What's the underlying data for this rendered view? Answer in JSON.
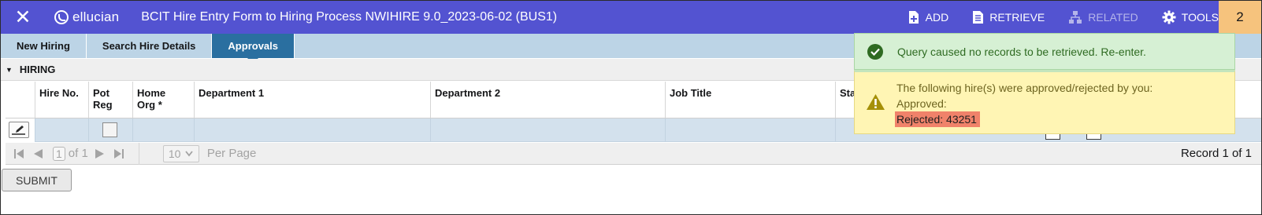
{
  "header": {
    "close_label": "✕",
    "logo_text": "ellucian",
    "form_title": "BCIT Hire Entry Form to Hiring Process NWIHIRE 9.0_2023-06-02 (BUS1)",
    "tools": [
      {
        "label": "ADD",
        "icon": "add-document-icon"
      },
      {
        "label": "RETRIEVE",
        "icon": "retrieve-document-icon"
      },
      {
        "label": "RELATED",
        "icon": "sitemap-icon",
        "disabled": true
      },
      {
        "label": "TOOLS",
        "icon": "gear-icon"
      }
    ],
    "notification_count": "2"
  },
  "tabs": [
    {
      "label": "New Hiring",
      "active": false
    },
    {
      "label": "Search Hire Details",
      "active": false
    },
    {
      "label": "Approvals",
      "active": true
    }
  ],
  "section": {
    "title": "HIRING"
  },
  "grid": {
    "columns": [
      {
        "line1": "Hire No.",
        "line2": ""
      },
      {
        "line1": "Pot",
        "line2": "Reg"
      },
      {
        "line1": "Home",
        "line2": "Org *"
      },
      {
        "line1": "Department 1",
        "line2": ""
      },
      {
        "line1": "Department 2",
        "line2": ""
      },
      {
        "line1": "Job Title",
        "line2": ""
      },
      {
        "line1": "Sta",
        "line2": ""
      }
    ]
  },
  "pager": {
    "page": "1",
    "of_label": "of 1",
    "per_page": "10",
    "per_page_label": "Per Page",
    "record_text": "Record 1 of 1"
  },
  "submit_label": "SUBMIT",
  "notifications": {
    "success": "Query caused no records to be retrieved. Re-enter.",
    "warning_line1": "The following hire(s) were approved/rejected by you:",
    "warning_line2": "Approved:",
    "warning_line3": "Rejected: 43251"
  },
  "colors": {
    "header": "#5353d1",
    "tab_bar": "#bcd4e6",
    "active_tab": "#2a6fa0",
    "notification_badge": "#f6c37d",
    "success_bg": "#d6f0d4",
    "warning_bg": "#fff5b4",
    "rejected_highlight": "#f0826a"
  }
}
